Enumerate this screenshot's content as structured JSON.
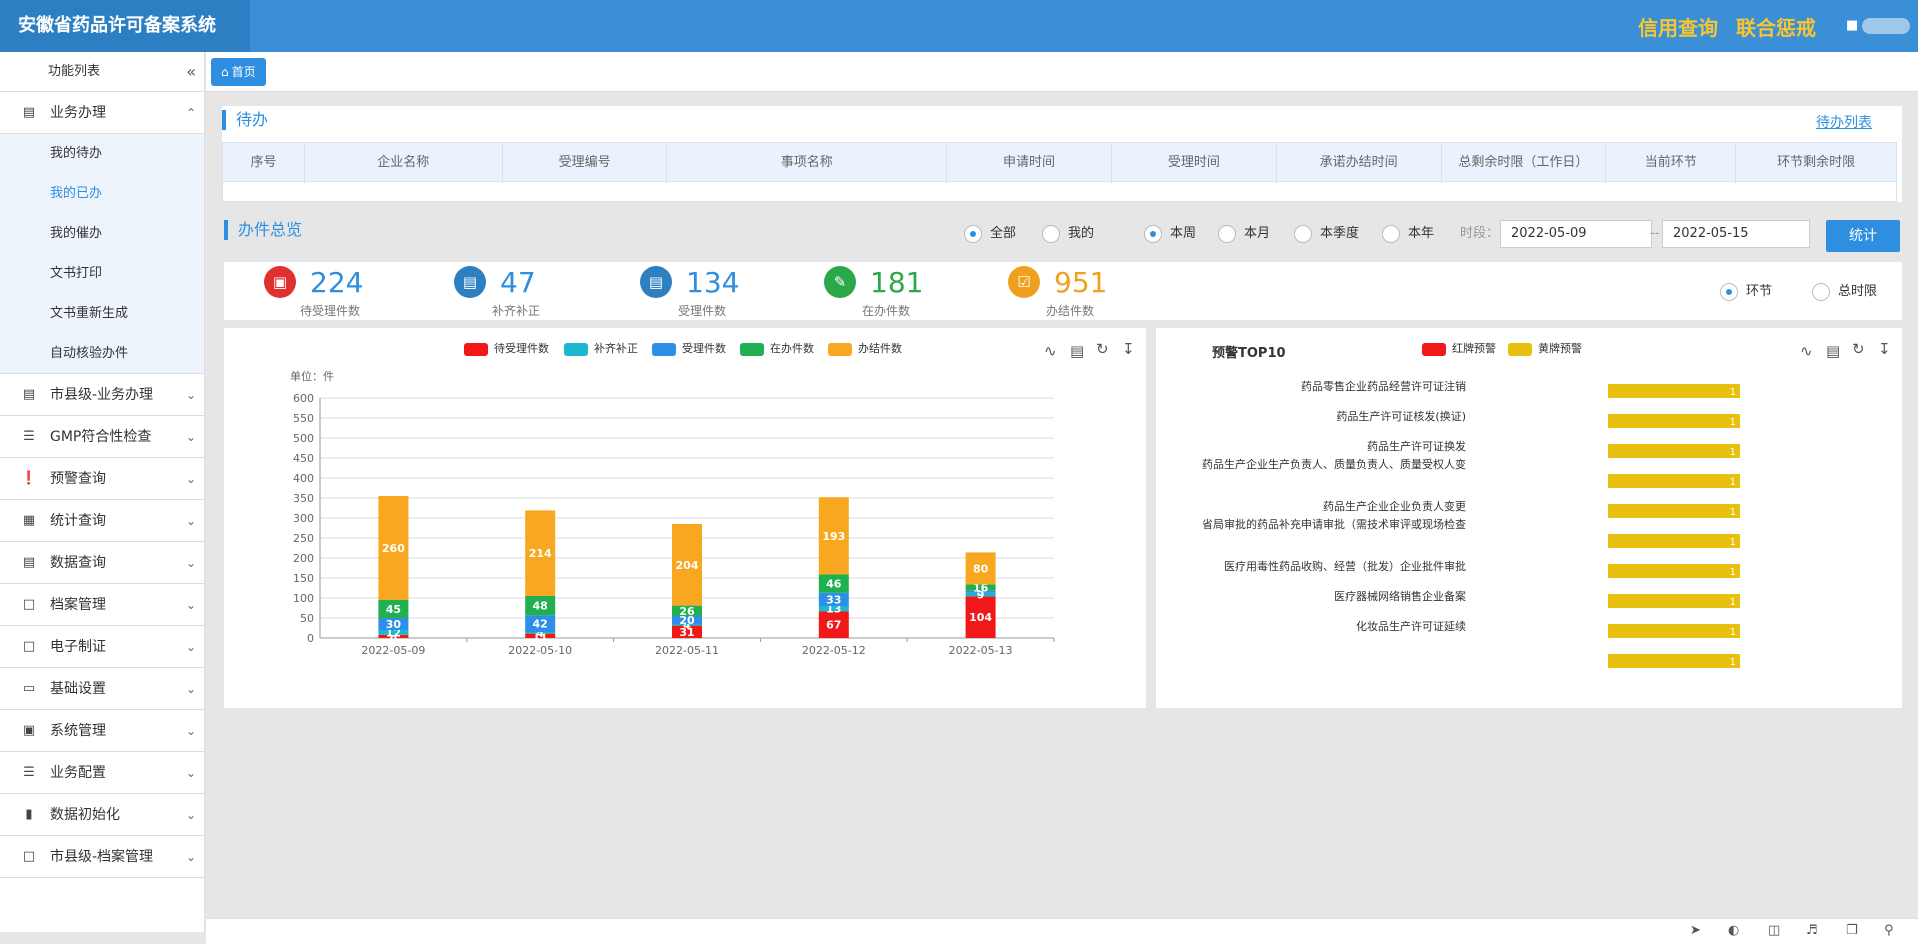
{
  "header": {
    "title": "安徽省药品许可备案系统",
    "credit_link": "信用查询",
    "joint_link": "联合惩戒"
  },
  "sidebar": {
    "title": "功能列表",
    "collapse_icon": "double-left-chevron-icon",
    "groups": [
      {
        "label": "业务办理",
        "icon": "bar-chart-icon",
        "expanded": true,
        "items": [
          "我的待办",
          "我的已办",
          "我的催办",
          "文书打印",
          "文书重新生成",
          "自动核验办件"
        ],
        "active_item": "我的已办"
      },
      {
        "label": "市县级-业务办理",
        "icon": "bar-chart-icon"
      },
      {
        "label": "GMP符合性检查",
        "icon": "server-icon"
      },
      {
        "label": "预警查询",
        "icon": "alert-icon"
      },
      {
        "label": "统计查询",
        "icon": "table-icon"
      },
      {
        "label": "数据查询",
        "icon": "document-search-icon"
      },
      {
        "label": "档案管理",
        "icon": "word-file-icon"
      },
      {
        "label": "电子制证",
        "icon": "file-icon"
      },
      {
        "label": "基础设置",
        "icon": "monitor-icon"
      },
      {
        "label": "系统管理",
        "icon": "calendar-icon"
      },
      {
        "label": "业务配置",
        "icon": "list-icon"
      },
      {
        "label": "数据初始化",
        "icon": "book-icon"
      },
      {
        "label": "市县级-档案管理",
        "icon": "word-file-icon"
      }
    ]
  },
  "tabs": [
    {
      "label": "首页",
      "icon": "home-icon"
    }
  ],
  "pending": {
    "title": "待办",
    "list_link": "待办列表",
    "columns": [
      "序号",
      "企业名称",
      "受理编号",
      "事项名称",
      "申请时间",
      "受理时间",
      "承诺办结时间",
      "总剩余时限（工作日）",
      "当前环节",
      "环节剩余时限"
    ]
  },
  "overview": {
    "title": "办件总览",
    "scope_options": [
      "全部",
      "我的"
    ],
    "scope_selected": "全部",
    "period_options": [
      "本周",
      "本月",
      "本季度",
      "本年"
    ],
    "period_selected": "本周",
    "range_label": "时段：",
    "date_from": "2022-05-09",
    "date_sep": "--",
    "date_to": "2022-05-15",
    "stat_button": "统计",
    "limit_options": [
      "环节",
      "总时限"
    ],
    "limit_selected": "环节",
    "stats": [
      {
        "value": "224",
        "label": "待受理件数",
        "color": "#e03030",
        "icon": "clipboard-icon"
      },
      {
        "value": "47",
        "label": "补齐补正",
        "color": "#2e7fc0",
        "icon": "document-icon"
      },
      {
        "value": "134",
        "label": "受理件数",
        "color": "#2e7fc0",
        "icon": "document-icon"
      },
      {
        "value": "181",
        "label": "在办件数",
        "color": "#2aa84a",
        "icon": "edit-icon"
      },
      {
        "value": "951",
        "label": "办结件数",
        "color": "#f0a020",
        "icon": "checklist-icon"
      }
    ]
  },
  "chart_data": [
    {
      "type": "bar",
      "stacked": true,
      "unit_label": "单位：件",
      "categories": [
        "2022-05-09",
        "2022-05-10",
        "2022-05-11",
        "2022-05-12",
        "2022-05-13"
      ],
      "ylim": [
        0,
        600
      ],
      "yticks": [
        0,
        50,
        100,
        150,
        200,
        250,
        300,
        350,
        400,
        450,
        500,
        550,
        600
      ],
      "grid": true,
      "legend_position": "top",
      "series": [
        {
          "name": "待受理件数",
          "color": "#f01818",
          "values": [
            8,
            11,
            31,
            67,
            104
          ]
        },
        {
          "name": "补齐补正",
          "color": "#1ab8d0",
          "values": [
            12,
            4,
            4,
            13,
            9
          ]
        },
        {
          "name": "受理件数",
          "color": "#2e8fe8",
          "values": [
            30,
            42,
            20,
            33,
            5
          ]
        },
        {
          "name": "在办件数",
          "color": "#20b050",
          "values": [
            45,
            48,
            26,
            46,
            16
          ]
        },
        {
          "name": "办结件数",
          "color": "#f8a820",
          "values": [
            260,
            214,
            204,
            193,
            80
          ]
        }
      ]
    },
    {
      "type": "bar",
      "orientation": "horizontal",
      "title": "预警TOP10",
      "legend_position": "top",
      "series": [
        {
          "name": "红牌预警",
          "color": "#f01818"
        },
        {
          "name": "黄牌预警",
          "color": "#e8c010"
        }
      ],
      "categories": [
        "药品零售企业药品经营许可证注销",
        "药品生产许可证核发(换证)",
        "药品生产许可证换发",
        "药品生产企业生产负责人、质量负责人、质量受权人变",
        "药品生产企业企业负责人变更",
        "省局审批的药品补充申请审批（需技术审评或现场检查",
        "医疗用毒性药品收购、经营（批发）企业批件审批",
        "医疗器械网络销售企业备案",
        "化妆品生产许可证延续",
        ""
      ],
      "values": [
        1,
        1,
        1,
        1,
        1,
        1,
        1,
        1,
        1,
        1
      ]
    }
  ],
  "chart_tools": [
    "line-chart-icon",
    "bar-chart-icon",
    "refresh-icon",
    "download-icon"
  ],
  "status_icons": [
    "rocket-icon",
    "speed-icon",
    "trash-icon",
    "volume-icon",
    "window-icon",
    "search-icon"
  ]
}
